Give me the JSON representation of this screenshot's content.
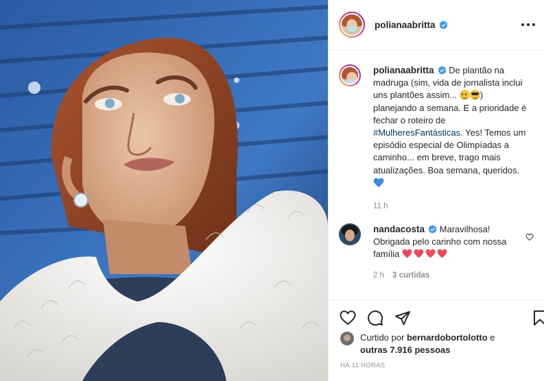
{
  "post": {
    "author": "polianaabritta",
    "verified": true,
    "caption": {
      "username": "polianaabritta",
      "line1": "De plantão na",
      "line2": "madruga (sim, vida de jornalista inclui",
      "line3a": "uns plantões assim...",
      "line3b": ")",
      "line4": "planejando a semana. E a prioridade é",
      "line5": "fechar o roteiro de",
      "hashtag": "#MulheresFantásticas",
      "line6b": ". Yes! Temos um",
      "line7": "episódio especial de Olimpíadas a",
      "line8": "caminho... em breve, trago mais",
      "line9": "atualizações. Boa semana, queridos.",
      "time": "11 h"
    },
    "comments": [
      {
        "username": "nandacosta",
        "verified": true,
        "line1": "Maravilhosa!",
        "line2": "Obrigada pelo carinho com nossa",
        "line3": "família",
        "time": "2 h",
        "likes": "3 curtidas"
      }
    ],
    "likes": {
      "prefix": "Curtido por",
      "user": "bernardobortolotto",
      "joiner": "e",
      "others": "outras 7.916 pessoas"
    },
    "timestamp": "HÁ 11 HORAS"
  },
  "icons": [
    "more-icon",
    "verified-badge-icon",
    "heart-icon",
    "comment-icon",
    "share-icon",
    "bookmark-icon",
    "smile-emoji",
    "sunglasses-emoji",
    "blue-heart-emoji",
    "red-heart-emoji"
  ],
  "colors": {
    "text": "#262626",
    "muted": "#8e8e8e",
    "link": "#00376b",
    "verified": "#3897f0",
    "red_heart": "#ed4956",
    "blue_heart": "#3d8be3"
  }
}
